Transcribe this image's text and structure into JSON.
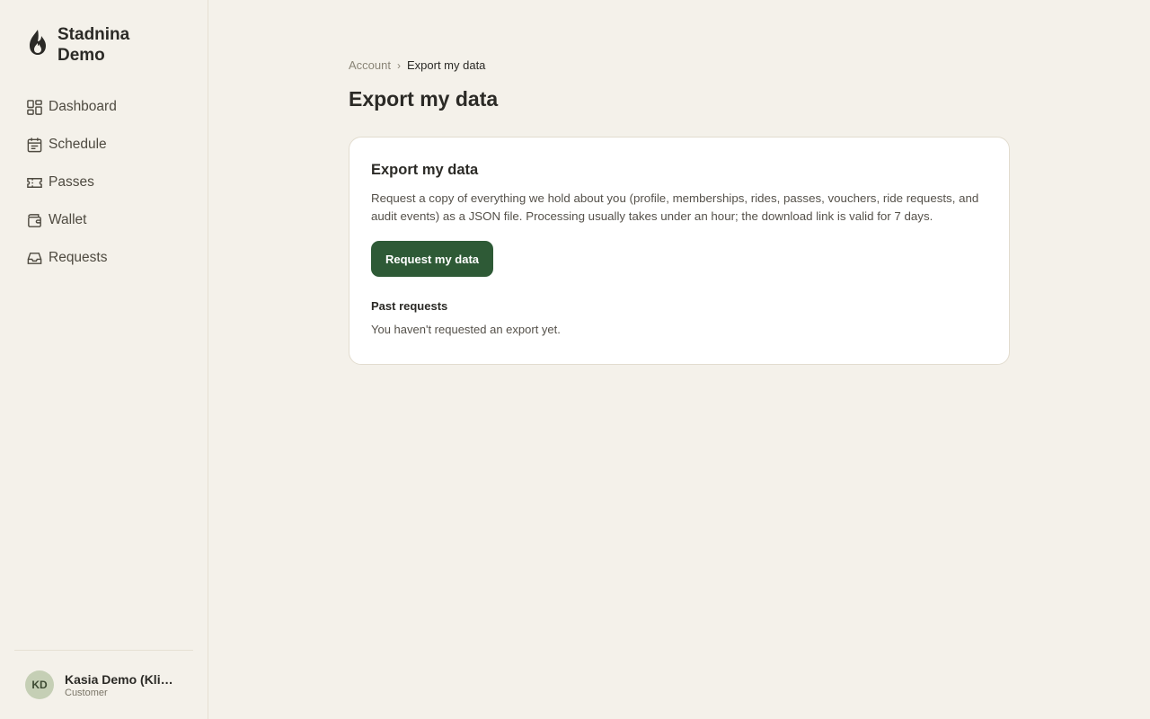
{
  "brand": {
    "name": "Stadnina Demo",
    "icon": "flame-logo-icon"
  },
  "nav": {
    "items": [
      {
        "label": "Dashboard",
        "icon": "dashboard-grid-icon"
      },
      {
        "label": "Schedule",
        "icon": "calendar-icon"
      },
      {
        "label": "Passes",
        "icon": "ticket-icon"
      },
      {
        "label": "Wallet",
        "icon": "wallet-icon"
      },
      {
        "label": "Requests",
        "icon": "inbox-icon"
      }
    ]
  },
  "user": {
    "initials": "KD",
    "name": "Kasia Demo (Klie…",
    "role": "Customer"
  },
  "breadcrumb": {
    "parent": "Account",
    "separator": "›",
    "current": "Export my data"
  },
  "page": {
    "title": "Export my data"
  },
  "card": {
    "title": "Export my data",
    "description": "Request a copy of everything we hold about you (profile, memberships, rides, passes, vouchers, ride requests, and audit events) as a JSON file. Processing usually takes under an hour; the download link is valid for 7 days.",
    "button_label": "Request my data",
    "past_title": "Past requests",
    "empty_text": "You haven't requested an export yet."
  },
  "colors": {
    "background": "#f4f1ea",
    "primary": "#2e5a36",
    "card": "#ffffff",
    "avatar": "#c5cfb5"
  }
}
